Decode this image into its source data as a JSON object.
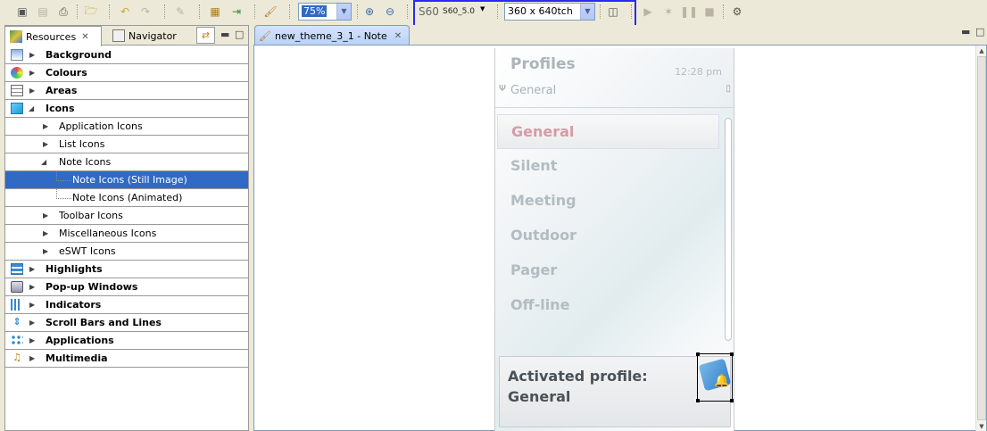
{
  "toolbar": {
    "zoom_value": "75%",
    "platform_label": "S60",
    "platform_version": "S60_5.0",
    "resolution_value": "360 x 640tch"
  },
  "left_panel": {
    "tabs": [
      {
        "label": "Resources",
        "active": true
      },
      {
        "label": "Navigator",
        "active": false
      }
    ],
    "tree": [
      {
        "label": "Background",
        "level": 0,
        "bold": true,
        "expanded": false,
        "icon": "background-icon"
      },
      {
        "label": "Colours",
        "level": 0,
        "bold": true,
        "expanded": false,
        "icon": "palette-icon"
      },
      {
        "label": "Areas",
        "level": 0,
        "bold": true,
        "expanded": false,
        "icon": "areas-icon"
      },
      {
        "label": "Icons",
        "level": 0,
        "bold": true,
        "expanded": true,
        "icon": "icons-icon"
      },
      {
        "label": "Application Icons",
        "level": 1,
        "bold": false,
        "expanded": false
      },
      {
        "label": "List Icons",
        "level": 1,
        "bold": false,
        "expanded": false
      },
      {
        "label": "Note Icons",
        "level": 1,
        "bold": false,
        "expanded": true
      },
      {
        "label": "Note Icons (Still Image)",
        "level": 2,
        "bold": false,
        "selected": true
      },
      {
        "label": "Note Icons (Animated)",
        "level": 2,
        "bold": false
      },
      {
        "label": "Toolbar Icons",
        "level": 1,
        "bold": false,
        "expanded": false
      },
      {
        "label": "Miscellaneous Icons",
        "level": 1,
        "bold": false,
        "expanded": false
      },
      {
        "label": "eSWT Icons",
        "level": 1,
        "bold": false,
        "expanded": false
      },
      {
        "label": "Highlights",
        "level": 0,
        "bold": true,
        "expanded": false,
        "icon": "highlights-icon"
      },
      {
        "label": "Pop-up Windows",
        "level": 0,
        "bold": true,
        "expanded": false,
        "icon": "popup-icon"
      },
      {
        "label": "Indicators",
        "level": 0,
        "bold": true,
        "expanded": false,
        "icon": "indicators-icon"
      },
      {
        "label": "Scroll Bars and Lines",
        "level": 0,
        "bold": true,
        "expanded": false,
        "icon": "scrollbars-icon"
      },
      {
        "label": "Applications",
        "level": 0,
        "bold": true,
        "expanded": false,
        "icon": "applications-icon"
      },
      {
        "label": "Multimedia",
        "level": 0,
        "bold": true,
        "expanded": false,
        "icon": "multimedia-icon"
      }
    ]
  },
  "editor": {
    "tab_label": "new_theme_3_1 - Note"
  },
  "phone": {
    "title": "Profiles",
    "time": "12:28 pm",
    "context": "General",
    "profiles": [
      "General",
      "Silent",
      "Meeting",
      "Outdoor",
      "Pager",
      "Off-line"
    ],
    "focused_index": 0,
    "activated_line1": "Activated profile:",
    "activated_line2": "General"
  },
  "colors": {
    "selection": "#316ac5",
    "highlight_box": "#2a2af0",
    "focused_text": "#d89aa4"
  }
}
